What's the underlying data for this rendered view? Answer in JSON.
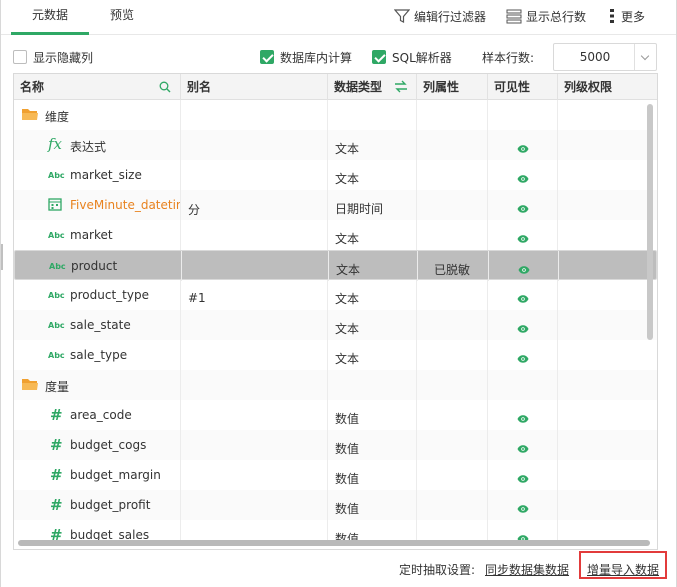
{
  "tabs": [
    {
      "label": "元数据",
      "active": true
    },
    {
      "label": "预览",
      "active": false
    }
  ],
  "toolbar": {
    "filter_label": "编辑行过滤器",
    "total_label": "显示总行数",
    "more_label": "更多"
  },
  "options": {
    "show_hidden_label": "显示隐藏列",
    "show_hidden_checked": false,
    "db_calc_label": "数据库内计算",
    "db_calc_checked": true,
    "sql_parser_label": "SQL解析器",
    "sql_parser_checked": true,
    "sample_rows_label": "样本行数:",
    "sample_rows_value": "5000"
  },
  "columns": {
    "name": "名称",
    "alias": "别名",
    "data_type": "数据类型",
    "col_attr": "列属性",
    "visible": "可见性",
    "col_perm": "列级权限"
  },
  "rows": [
    {
      "kind": "folder",
      "name": "维度",
      "alias": "",
      "type": "",
      "attr": "",
      "visible": false
    },
    {
      "kind": "expr",
      "name": "表达式",
      "alias": "",
      "type": "文本",
      "attr": "",
      "visible": true
    },
    {
      "kind": "abc",
      "name": "market_size",
      "alias": "",
      "type": "文本",
      "attr": "",
      "visible": true
    },
    {
      "kind": "date",
      "name": "FiveMinute_datetime",
      "alias": "分",
      "type": "日期时间",
      "attr": "",
      "visible": true,
      "name_color": "#e8821e"
    },
    {
      "kind": "abc",
      "name": "market",
      "alias": "",
      "type": "文本",
      "attr": "",
      "visible": true
    },
    {
      "kind": "abc",
      "name": "product",
      "alias": "",
      "type": "文本",
      "attr": "已脱敏",
      "visible": true,
      "selected": true
    },
    {
      "kind": "abc",
      "name": "product_type",
      "alias": "#1",
      "type": "文本",
      "attr": "",
      "visible": true
    },
    {
      "kind": "abc",
      "name": "sale_state",
      "alias": "",
      "type": "文本",
      "attr": "",
      "visible": true
    },
    {
      "kind": "abc",
      "name": "sale_type",
      "alias": "",
      "type": "文本",
      "attr": "",
      "visible": true
    },
    {
      "kind": "folder",
      "name": "度量",
      "alias": "",
      "type": "",
      "attr": "",
      "visible": false
    },
    {
      "kind": "num",
      "name": "area_code",
      "alias": "",
      "type": "数值",
      "attr": "",
      "visible": true
    },
    {
      "kind": "num",
      "name": "budget_cogs",
      "alias": "",
      "type": "数值",
      "attr": "",
      "visible": true
    },
    {
      "kind": "num",
      "name": "budget_margin",
      "alias": "",
      "type": "数值",
      "attr": "",
      "visible": true
    },
    {
      "kind": "num",
      "name": "budget_profit",
      "alias": "",
      "type": "数值",
      "attr": "",
      "visible": true
    },
    {
      "kind": "num",
      "name": "budget_sales",
      "alias": "",
      "type": "数值",
      "attr": "",
      "visible": true
    }
  ],
  "icon_text": {
    "abc": "Abc",
    "num": "#",
    "expr": "fx"
  },
  "footer": {
    "schedule_label": "定时抽取设置:",
    "sync_link": "同步数据集数据",
    "incremental_link": "增量导入数据"
  },
  "colors": {
    "accent": "#2fa865",
    "folder": "#f0a030",
    "highlight": "#e23b3b",
    "selected_row": "#bdbdbd"
  }
}
